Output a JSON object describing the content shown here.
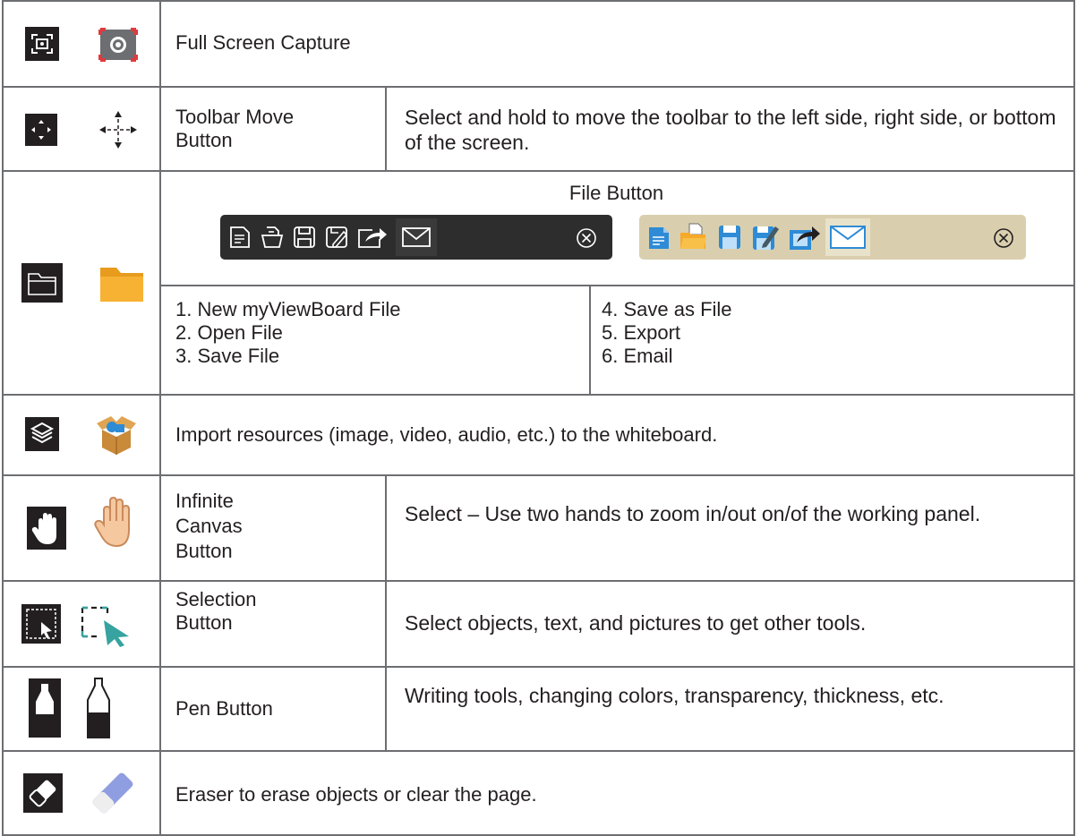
{
  "rows": {
    "full_screen": {
      "label": "Full Screen Capture"
    },
    "toolbar_move": {
      "name_line1": "Toolbar Move",
      "name_line2": "Button",
      "description": "Select and hold to move the toolbar to the left side, right side, or bottom of the screen."
    },
    "file": {
      "title": "File Button",
      "items_left": [
        "1. New myViewBoard File",
        "2. Open File",
        "3. Save File"
      ],
      "items_right": [
        "4. Save as File",
        "5. Export",
        "6. Email"
      ]
    },
    "import": {
      "description": "Import resources (image, video, audio, etc.) to the whiteboard."
    },
    "infinite_canvas": {
      "name_line1": "Infinite",
      "name_line2": "Canvas",
      "name_line3": "Button",
      "description": "Select – Use two hands to zoom in/out on/of the working panel."
    },
    "selection": {
      "name_line1": "Selection",
      "name_line2": "Button",
      "description": "Select objects, text, and pictures to get other tools."
    },
    "pen": {
      "name": "Pen Button",
      "description": "Writing tools, changing colors, transparency, thickness, etc."
    },
    "eraser": {
      "description": "Eraser to erase objects or clear the page."
    }
  },
  "colors": {
    "border": "#6d6e71",
    "dark_icon_bg": "#231f20",
    "accent_blue": "#2e8bd6",
    "folder_orange": "#f7a928",
    "toolbar_dark": "#2d2d2d",
    "toolbar_light": "#d9cfae"
  }
}
